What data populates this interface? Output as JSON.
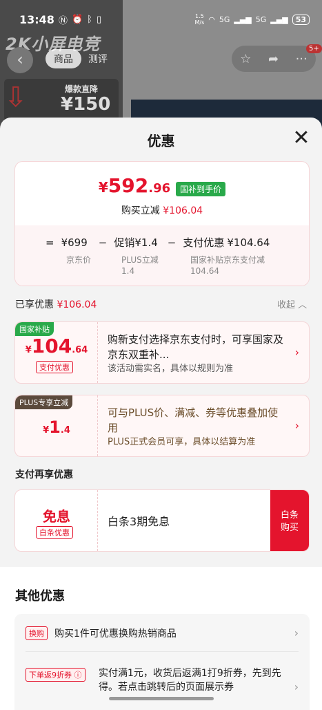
{
  "status_bar": {
    "time": "13:48",
    "net_speed_value": "1.5",
    "net_speed_unit": "M/s",
    "signal1": "5G",
    "signal2": "5G",
    "battery": "53"
  },
  "background": {
    "brand_text": "2K小屏电竞",
    "tab_active": "商品",
    "tab_other": "测评",
    "promo_line1": "爆款直降",
    "promo_line2": "¥150",
    "badge": "5+",
    "icons": [
      "back-icon",
      "star-icon",
      "share-icon",
      "more-icon"
    ]
  },
  "sheet": {
    "title": "优惠",
    "close_icon": "close-icon"
  },
  "price": {
    "yen": "¥",
    "integer": "592",
    "decimal": ".96",
    "tag": "国补到手价",
    "sub_label": "购买立减",
    "sub_amount": "¥106.04",
    "equation": {
      "eq": "=",
      "base": "¥699",
      "op1": "−",
      "promo_label": "促销",
      "promo_amount": "¥1.4",
      "op2": "−",
      "pay_label": "支付优惠",
      "pay_amount": "¥104.64"
    },
    "labels": {
      "base": "京东价",
      "promo_line1": "PLUS立减",
      "promo_line2": "1.4",
      "pay_line1": "国家补贴京东支付减",
      "pay_line2": "104.64"
    }
  },
  "enjoyed": {
    "label": "已享优惠",
    "amount": "¥106.04",
    "collapse": "收起",
    "collapse_icon": "chevron-up-icon"
  },
  "deals": [
    {
      "tag": "国家补贴",
      "tag_color": "#29a94a",
      "yen": "¥",
      "integer": "104",
      "decimal": ".64",
      "sublabel": "支付优惠",
      "text": "购新支付选择京东支付时，可享国家及京东双重补...",
      "note": "该活动需实名，具体以规则为准"
    },
    {
      "tag": "PLUS专享立减",
      "tag_color": "#5b4a3c",
      "yen": "¥",
      "integer": "1",
      "decimal": ".4",
      "text": "可与PLUS价、满减、券等优惠叠加使用",
      "note": "PLUS正式会员可享，具体以结算为准"
    }
  ],
  "pay_section": {
    "label": "支付再享优惠",
    "big": "免息",
    "sub": "白条优惠",
    "text": "白条3期免息",
    "button_line1": "白条",
    "button_line2": "购买"
  },
  "other": {
    "title": "其他优惠",
    "row1_pill": "换购",
    "row1_text": "购买1件可优惠换购热销商品",
    "row2_pill": "下单返9折券",
    "row2_text": "实付满1元，收货后返满1打9折券，先到先得。若点击跳转后的页面展示券"
  },
  "colors": {
    "accent_red": "#e4142d",
    "green_tag": "#29a94a"
  }
}
